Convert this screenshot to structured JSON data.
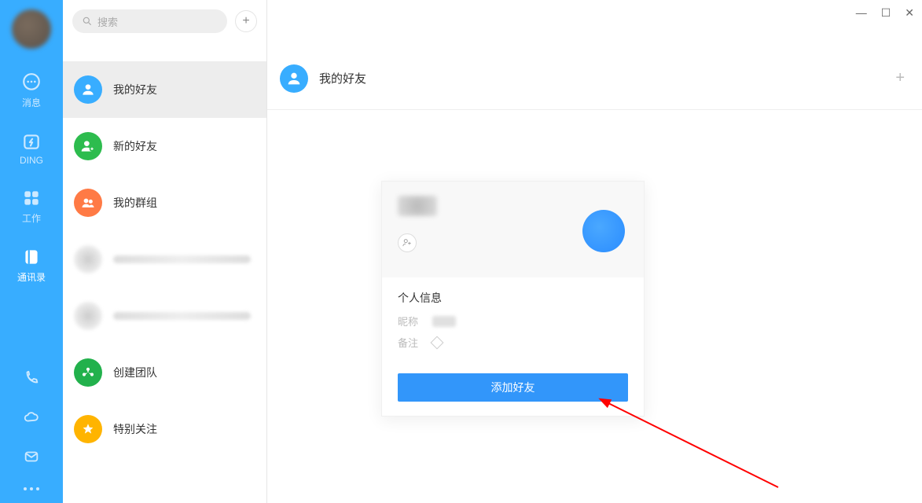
{
  "rail": {
    "items": [
      {
        "key": "messages",
        "label": "消息"
      },
      {
        "key": "ding",
        "label": "DING"
      },
      {
        "key": "work",
        "label": "工作"
      },
      {
        "key": "contacts",
        "label": "通讯录"
      }
    ],
    "active_index": 3
  },
  "panel": {
    "search_placeholder": "搜索",
    "rows": [
      {
        "key": "my-friends",
        "label": "我的好友",
        "color": "#38adff",
        "icon": "person"
      },
      {
        "key": "new-friends",
        "label": "新的好友",
        "color": "#2dbc4e",
        "icon": "person-plus"
      },
      {
        "key": "my-groups",
        "label": "我的群组",
        "color": "#ff7a45",
        "icon": "people"
      },
      {
        "key": "blur1",
        "blur": true
      },
      {
        "key": "blur2",
        "blur": true
      },
      {
        "key": "create-team",
        "label": "创建团队",
        "color": "#22b14c",
        "icon": "team"
      },
      {
        "key": "starred",
        "label": "特别关注",
        "color": "#ffb400",
        "icon": "star"
      }
    ],
    "selected_index": 0
  },
  "main": {
    "title": "我的好友"
  },
  "card": {
    "section_title": "个人信息",
    "nickname_label": "昵称",
    "remark_label": "备注",
    "button_label": "添加好友"
  }
}
